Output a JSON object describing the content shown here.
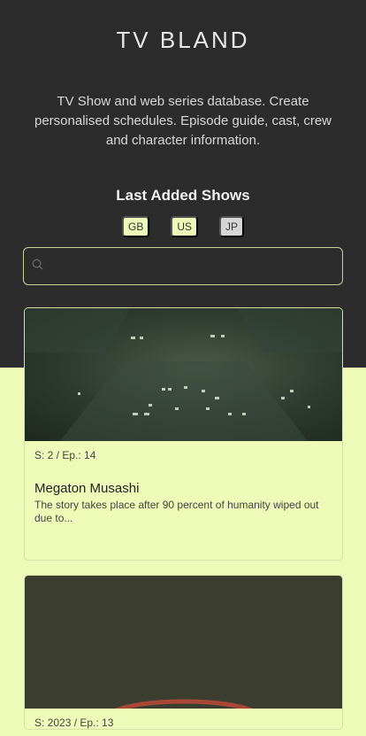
{
  "site": {
    "title": "TV BLAND",
    "tagline": "TV Show and web series database. Create personalised schedules. Episode guide, cast, crew and character information."
  },
  "section": {
    "title": "Last Added Shows"
  },
  "filters": [
    {
      "label": "GB",
      "active": true
    },
    {
      "label": "US",
      "active": true
    },
    {
      "label": "JP",
      "active": false
    }
  ],
  "search": {
    "placeholder": "",
    "value": ""
  },
  "shows": [
    {
      "meta": "S: 2 / Ep.: 14",
      "title": "Megaton Musashi",
      "description": "The story takes place after 90 percent of humanity wiped out due to..."
    },
    {
      "meta": "S: 2023 / Ep.: 13"
    }
  ],
  "colors": {
    "header_bg": "#2c2c2c",
    "accent": "#eefab8",
    "inactive_chip": "#d6d6d6"
  }
}
